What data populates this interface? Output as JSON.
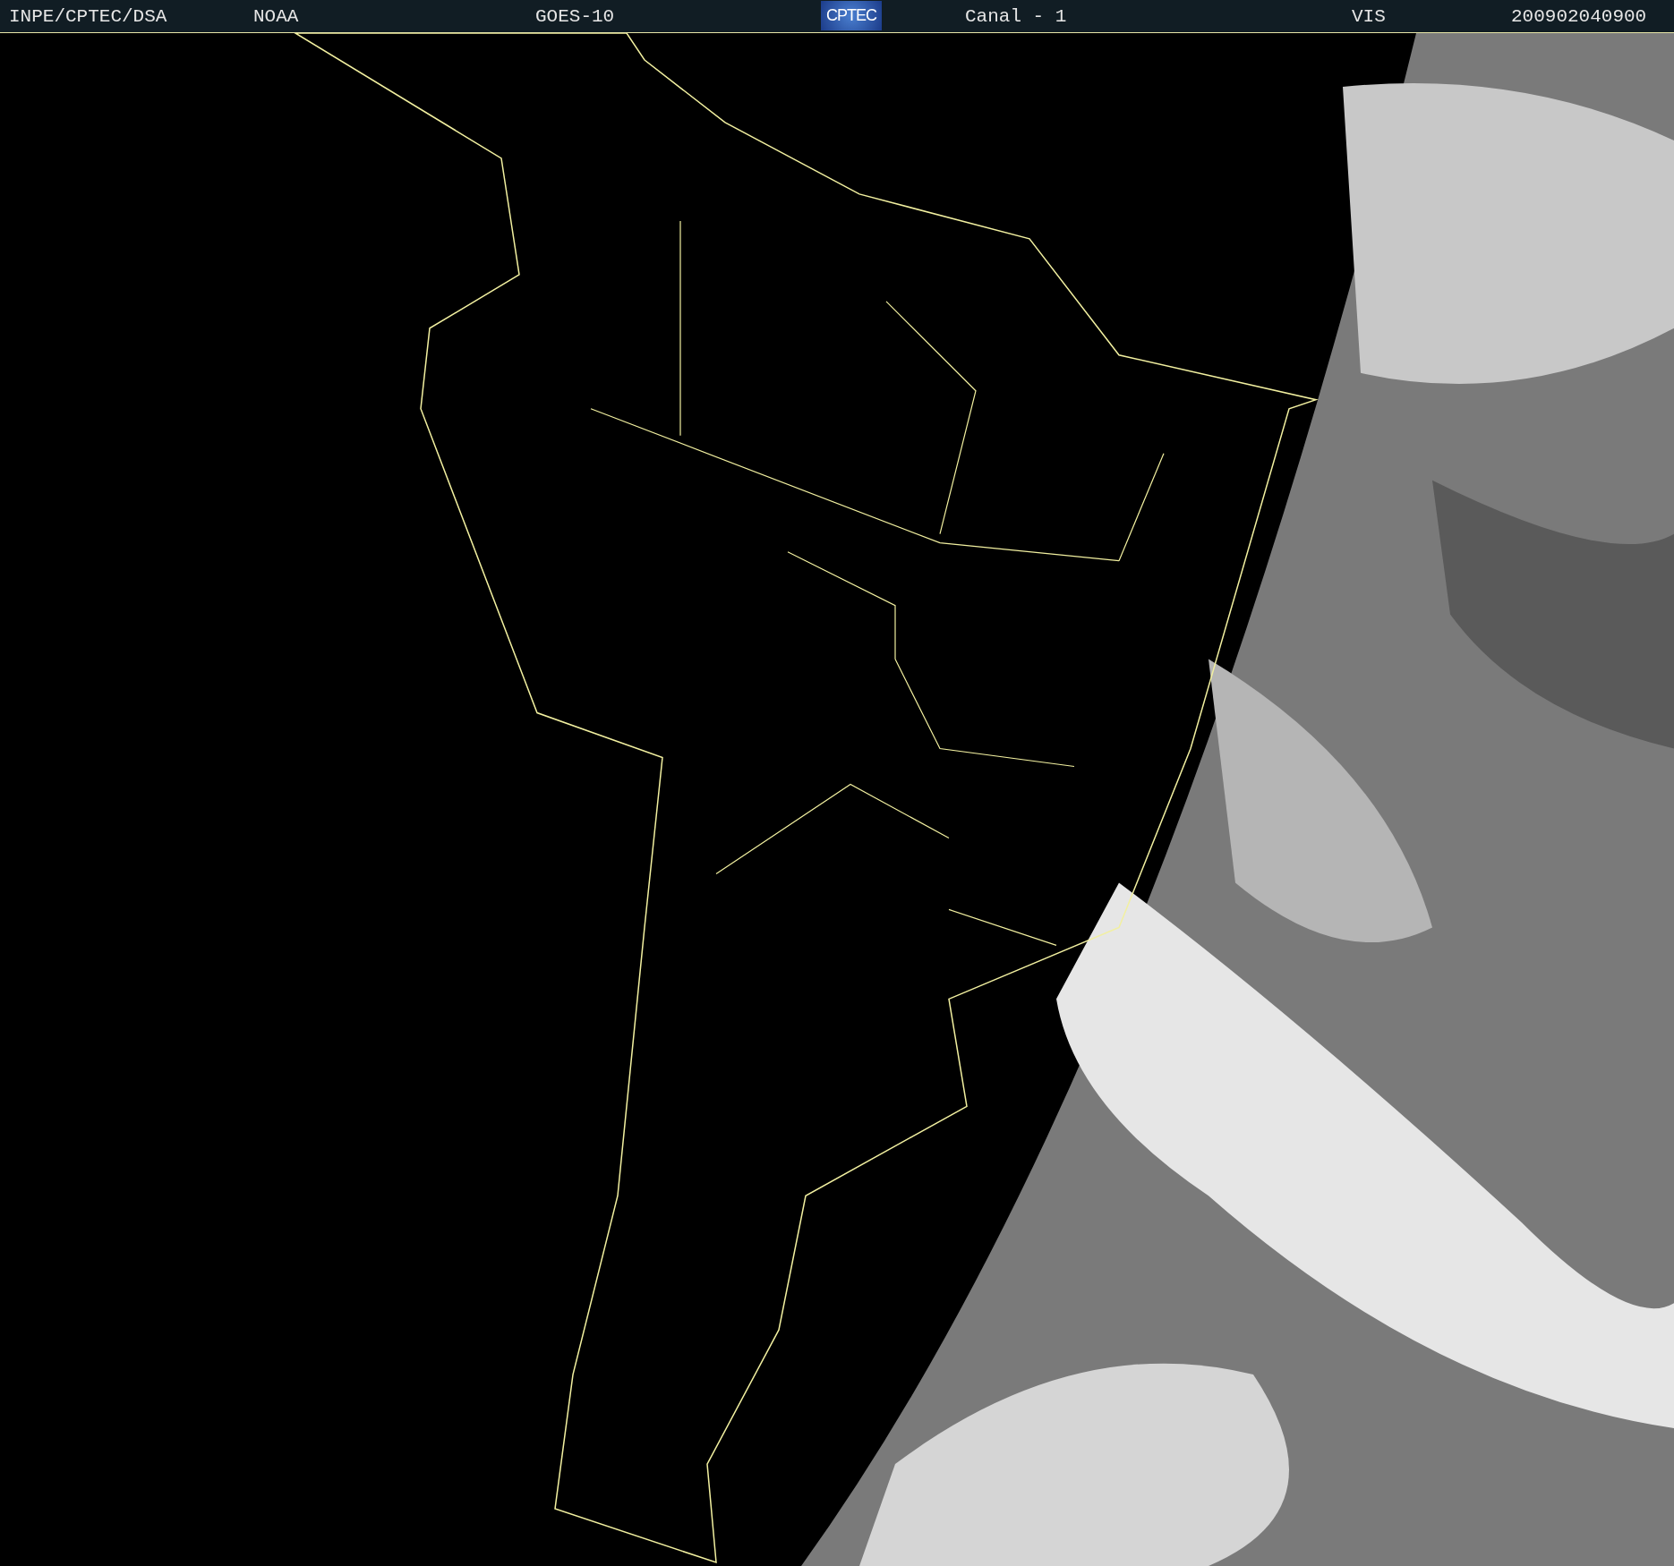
{
  "header": {
    "source": "INPE/CPTEC/DSA",
    "agency": "NOAA",
    "satellite": "GOES-10",
    "logo": "CPTEC",
    "channel": "Canal - 1",
    "band": "VIS",
    "timestamp": "200902040900"
  }
}
